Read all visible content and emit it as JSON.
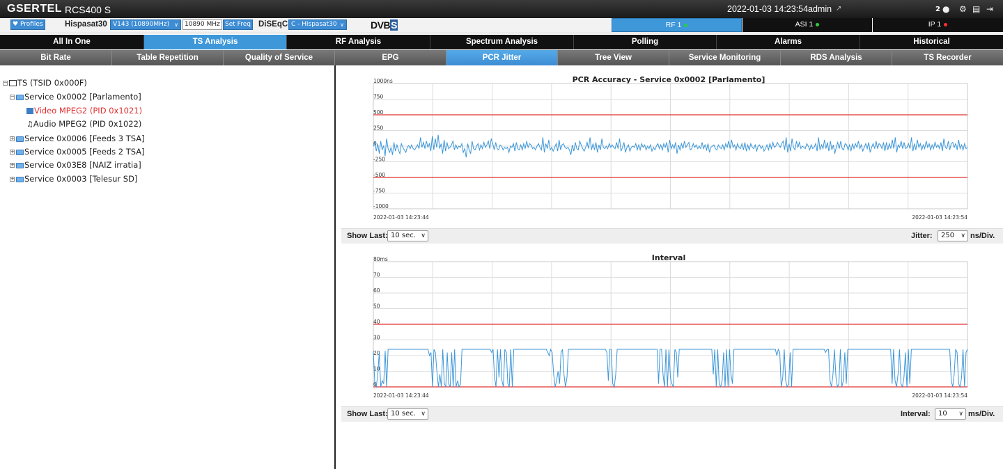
{
  "header": {
    "brand": "GSERTEL",
    "model": "RCS400 S",
    "datetime": "2022-01-03 14:23:54",
    "user": "admin",
    "message_count": "2"
  },
  "toolbar": {
    "profiles_label": "Profiles",
    "satellite_label": "Hispasat30",
    "transponder_value": "V143 (10890MHz)",
    "frequency_value": "10890 MHz",
    "set_freq_label": "Set Freq",
    "diseqc_label": "DiSEqC",
    "diseqc_value": "C - Hispasat30",
    "standard_logo": "DVB",
    "standard_logo_s": "S"
  },
  "inputs": [
    {
      "label": "RF 1",
      "status_color": "#2ecc40",
      "active": true
    },
    {
      "label": "ASI 1",
      "status_color": "#2ecc40",
      "active": false
    },
    {
      "label": "IP 1",
      "status_color": "#ff3030",
      "active": false
    }
  ],
  "main_tabs": [
    "All In One",
    "TS Analysis",
    "RF Analysis",
    "Spectrum Analysis",
    "Polling",
    "Alarms",
    "Historical"
  ],
  "main_tab_active": 1,
  "sub_tabs": [
    "Bit Rate",
    "Table Repetition",
    "Quality of Service",
    "EPG",
    "PCR Jitter",
    "Tree View",
    "Service Monitoring",
    "RDS Analysis",
    "TS Recorder"
  ],
  "sub_tab_active": 4,
  "tree": {
    "root": "TS (TSID 0x000F)",
    "service_open": "Service 0x0002 [Parlamento]",
    "video": "Video MPEG2 (PID 0x1021)",
    "audio": "Audio MPEG2 (PID 0x1022)",
    "services": [
      "Service 0x0006 [Feeds 3 TSA]",
      "Service 0x0005 [Feeds 2 TSA]",
      "Service 0x03E8 [NAIZ irratia]",
      "Service 0x0003 [Telesur SD]"
    ]
  },
  "controls": {
    "show_last_label": "Show Last:",
    "show_last_value": "10 sec.",
    "jitter_label": "Jitter:",
    "jitter_value": "250",
    "jitter_unit": "ns/Div.",
    "interval_label": "Interval:",
    "interval_value": "10",
    "interval_unit": "ms/Div."
  },
  "chart_data": [
    {
      "type": "line",
      "title": "PCR Accuracy - Service 0x0002 [Parlamento]",
      "y_tick_labels": [
        "1000ns",
        "750",
        "500",
        "250",
        "0",
        "-250",
        "-500",
        "-750",
        "-1000"
      ],
      "ylim": [
        -1000,
        1000
      ],
      "x_range": [
        "2022-01-03 14:23:44",
        "2022-01-03 14:23:54"
      ],
      "x_start_label": "2022-01-03 14:23:44",
      "x_end_label": "2022-01-03 14:23:54",
      "grid": true,
      "limit_lines": [
        500,
        -500
      ],
      "limit_color": "#e03030",
      "series_color": "#3d97d9",
      "values": [
        0,
        60,
        -80,
        40,
        -120,
        80,
        -60,
        10,
        -160,
        120,
        -40,
        -100,
        -20,
        -140,
        60,
        -80,
        20,
        -60,
        -120,
        40,
        -20,
        -60,
        -100,
        -20,
        10,
        -40,
        20,
        -40,
        -60,
        -20,
        20,
        -40,
        140,
        -20,
        60,
        -40,
        80,
        -20,
        40,
        -80,
        160,
        -60,
        120,
        -20,
        180,
        -40,
        40,
        -120,
        100,
        -80,
        60,
        -40,
        -20,
        20,
        80,
        -60,
        20,
        -40,
        0,
        -20,
        40,
        -100,
        -40,
        -180,
        40,
        -60,
        -120,
        80,
        -40,
        -60,
        0,
        40,
        -60,
        20,
        -40,
        60,
        -20,
        20,
        80,
        -40,
        120,
        40,
        -60,
        60,
        -40,
        -60,
        20,
        0,
        -60,
        -20,
        -40,
        -20,
        -100,
        0,
        -20,
        40,
        -80,
        60,
        -40,
        -60,
        20,
        -60,
        40,
        -40,
        80,
        -20,
        40,
        20,
        -40,
        -20,
        -60,
        0,
        40,
        -20,
        -60,
        140,
        -100,
        40,
        -40,
        100,
        -60,
        -20,
        -80,
        -20,
        40,
        -80,
        100,
        -60,
        20,
        40,
        -20,
        -40,
        -20,
        -60,
        -140,
        20,
        -80,
        60,
        -40,
        -60,
        80,
        20,
        -40,
        -80,
        -20,
        60,
        -40,
        140,
        -60,
        40,
        -60,
        60,
        -100,
        20,
        -60,
        120,
        -20,
        -40,
        0,
        -40,
        40,
        -20,
        20,
        -20,
        -40,
        60,
        -40,
        120,
        -80,
        -20,
        60,
        -100,
        -20,
        20,
        -80,
        -20,
        0,
        -20,
        40,
        -60,
        20,
        -60,
        40,
        -20,
        20,
        -60,
        0,
        -40,
        20,
        -80,
        -20,
        -60,
        0,
        40,
        -40,
        20,
        -60,
        40,
        -20,
        60,
        -100,
        100,
        -40,
        20,
        -40,
        60,
        -120,
        20,
        -60,
        40,
        -40,
        80,
        -20,
        20,
        60,
        -60,
        -40,
        40,
        -20,
        20,
        -40,
        0,
        -40,
        60,
        -40,
        20,
        -60,
        40,
        -100,
        -20,
        0,
        20,
        -40,
        -60,
        20,
        -20,
        -40,
        20,
        -60,
        40,
        -20,
        80,
        -40,
        100,
        -20,
        20,
        -60,
        40,
        -20,
        -40,
        40,
        -60,
        60,
        -80,
        20,
        -60,
        40,
        -20,
        -40,
        20,
        -80,
        0,
        20,
        -40,
        0,
        -80,
        -40,
        20,
        -60,
        40,
        -40,
        60,
        -20,
        0,
        60,
        20,
        -20,
        40,
        80,
        -60,
        140,
        -100,
        40,
        -80,
        120,
        -20,
        -60,
        80,
        -20,
        60,
        -40,
        0,
        -20,
        -40,
        40,
        0,
        -60,
        20,
        -40,
        -20,
        40,
        -80,
        140,
        -60,
        20,
        -40,
        100,
        -40,
        60,
        -80,
        80,
        -60,
        20,
        -120,
        -20,
        60,
        -40,
        80,
        -40,
        -60,
        40,
        20,
        -60,
        20,
        -80,
        40,
        -40,
        40,
        -20,
        80,
        -40,
        20,
        -80,
        -20,
        40,
        -40,
        60,
        -100,
        -20,
        40,
        -40,
        80,
        -40,
        40,
        20,
        -40,
        60,
        -80,
        60,
        -60,
        40,
        -40,
        100,
        -40,
        140,
        -100,
        20,
        -20,
        80,
        -40,
        60,
        -40,
        -20,
        40,
        -40,
        140,
        -80,
        40,
        -60,
        100,
        -20,
        40,
        -60,
        20,
        -40,
        80,
        -20,
        40,
        -60,
        20,
        -40,
        60,
        -20,
        20,
        -40,
        60,
        -80,
        120,
        -20,
        -40,
        80,
        -60,
        40,
        60,
        -20,
        40,
        -60,
        100,
        -40,
        20,
        -60,
        40,
        -40,
        -20
      ]
    },
    {
      "type": "line",
      "title": "Interval",
      "y_tick_labels": [
        "80ms",
        "70",
        "60",
        "50",
        "40",
        "30",
        "20",
        "10",
        "0"
      ],
      "ylim": [
        0,
        80
      ],
      "x_range": [
        "2022-01-03 14:23:44",
        "2022-01-03 14:23:54"
      ],
      "x_start_label": "2022-01-03 14:23:44",
      "x_end_label": "2022-01-03 14:23:54",
      "grid": true,
      "limit_lines": [
        40,
        0
      ],
      "limit_color": "#e03030",
      "series_color": "#3d97d9",
      "values": [
        23,
        2,
        0,
        8,
        22,
        0,
        4,
        2,
        23,
        0,
        24,
        24,
        24,
        24,
        24,
        24,
        24,
        24,
        24,
        24,
        24,
        24,
        24,
        24,
        24,
        24,
        24,
        24,
        24,
        24,
        24,
        24,
        24,
        24,
        24,
        24,
        24,
        24,
        20,
        22,
        0,
        24,
        22,
        10,
        0,
        8,
        0,
        24,
        2,
        0,
        22,
        2,
        0,
        22,
        0,
        24,
        0,
        4,
        0,
        2,
        24,
        24,
        24,
        24,
        24,
        24,
        24,
        24,
        24,
        24,
        24,
        24,
        24,
        24,
        24,
        24,
        24,
        24,
        24,
        24,
        22,
        24,
        6,
        0,
        24,
        6,
        24,
        4,
        0,
        24,
        22,
        2,
        0,
        24,
        0,
        24,
        24,
        24,
        24,
        24,
        24,
        24,
        24,
        24,
        24,
        24,
        24,
        24,
        24,
        24,
        24,
        24,
        24,
        24,
        24,
        24,
        24,
        24,
        22,
        20,
        24,
        22,
        8,
        0,
        4,
        10,
        2,
        22,
        24,
        8,
        0,
        6,
        24,
        24,
        24,
        24,
        24,
        24,
        24,
        24,
        24,
        24,
        24,
        24,
        24,
        24,
        24,
        24,
        24,
        24,
        24,
        24,
        24,
        24,
        24,
        24,
        24,
        24,
        22,
        4,
        24,
        24,
        2,
        0,
        8,
        24,
        24,
        24,
        24,
        24,
        24,
        24,
        24,
        24,
        24,
        24,
        24,
        24,
        24,
        24,
        24,
        24,
        24,
        24,
        24,
        24,
        24,
        24,
        24,
        24,
        24,
        24,
        24,
        2,
        24,
        24,
        8,
        0,
        24,
        0,
        24,
        6,
        2,
        0,
        24,
        22,
        6,
        24,
        24,
        24,
        24,
        24,
        24,
        24,
        24,
        24,
        24,
        24,
        24,
        24,
        24,
        24,
        24,
        24,
        24,
        24,
        24,
        24,
        24,
        24,
        8,
        24,
        0,
        24,
        2,
        0,
        4,
        22,
        0,
        24,
        0,
        24,
        8,
        2,
        24,
        24,
        24,
        24,
        24,
        24,
        24,
        24,
        24,
        24,
        24,
        24,
        24,
        24,
        24,
        24,
        24,
        24,
        24,
        24,
        24,
        24,
        24,
        24,
        24,
        24,
        24,
        24,
        24,
        20,
        24,
        22,
        0,
        6,
        24,
        4,
        0,
        2,
        22,
        0,
        24,
        24,
        24,
        24,
        24,
        24,
        24,
        24,
        24,
        24,
        24,
        24,
        24,
        24,
        24,
        24,
        24,
        24,
        24,
        24,
        24,
        24,
        22,
        24,
        24,
        4,
        0,
        8,
        24,
        6,
        0,
        2,
        24,
        0,
        4,
        22,
        2,
        24,
        24,
        24,
        24,
        24,
        24,
        24,
        24,
        24,
        24,
        24,
        24,
        24,
        24,
        24,
        24,
        24,
        24,
        24,
        24,
        24,
        24,
        24,
        24,
        24,
        24,
        24,
        24,
        24,
        24,
        2,
        24,
        4,
        0,
        8,
        24,
        2,
        0,
        6,
        22,
        0,
        24,
        2,
        24,
        24,
        24,
        24,
        24,
        24,
        24,
        24,
        24,
        24,
        24,
        24,
        24,
        24,
        24,
        24,
        24,
        24,
        24,
        24,
        24,
        24,
        24,
        24,
        24,
        24,
        24,
        4,
        0,
        8,
        24,
        22,
        2,
        0,
        6,
        24,
        0,
        22,
        24
      ]
    }
  ]
}
